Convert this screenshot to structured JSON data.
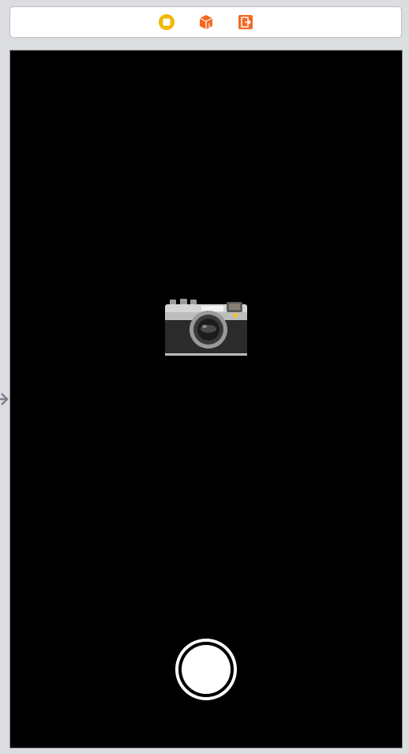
{
  "dock": {
    "icons": [
      {
        "name": "view-controller-icon",
        "color": "#f2b705"
      },
      {
        "name": "first-responder-icon",
        "color": "#f26a21"
      },
      {
        "name": "exit-icon",
        "color": "#f26a21"
      }
    ]
  },
  "view": {
    "background": "#000000",
    "image": "camera-icon",
    "shutter_button": "shutter-button"
  }
}
